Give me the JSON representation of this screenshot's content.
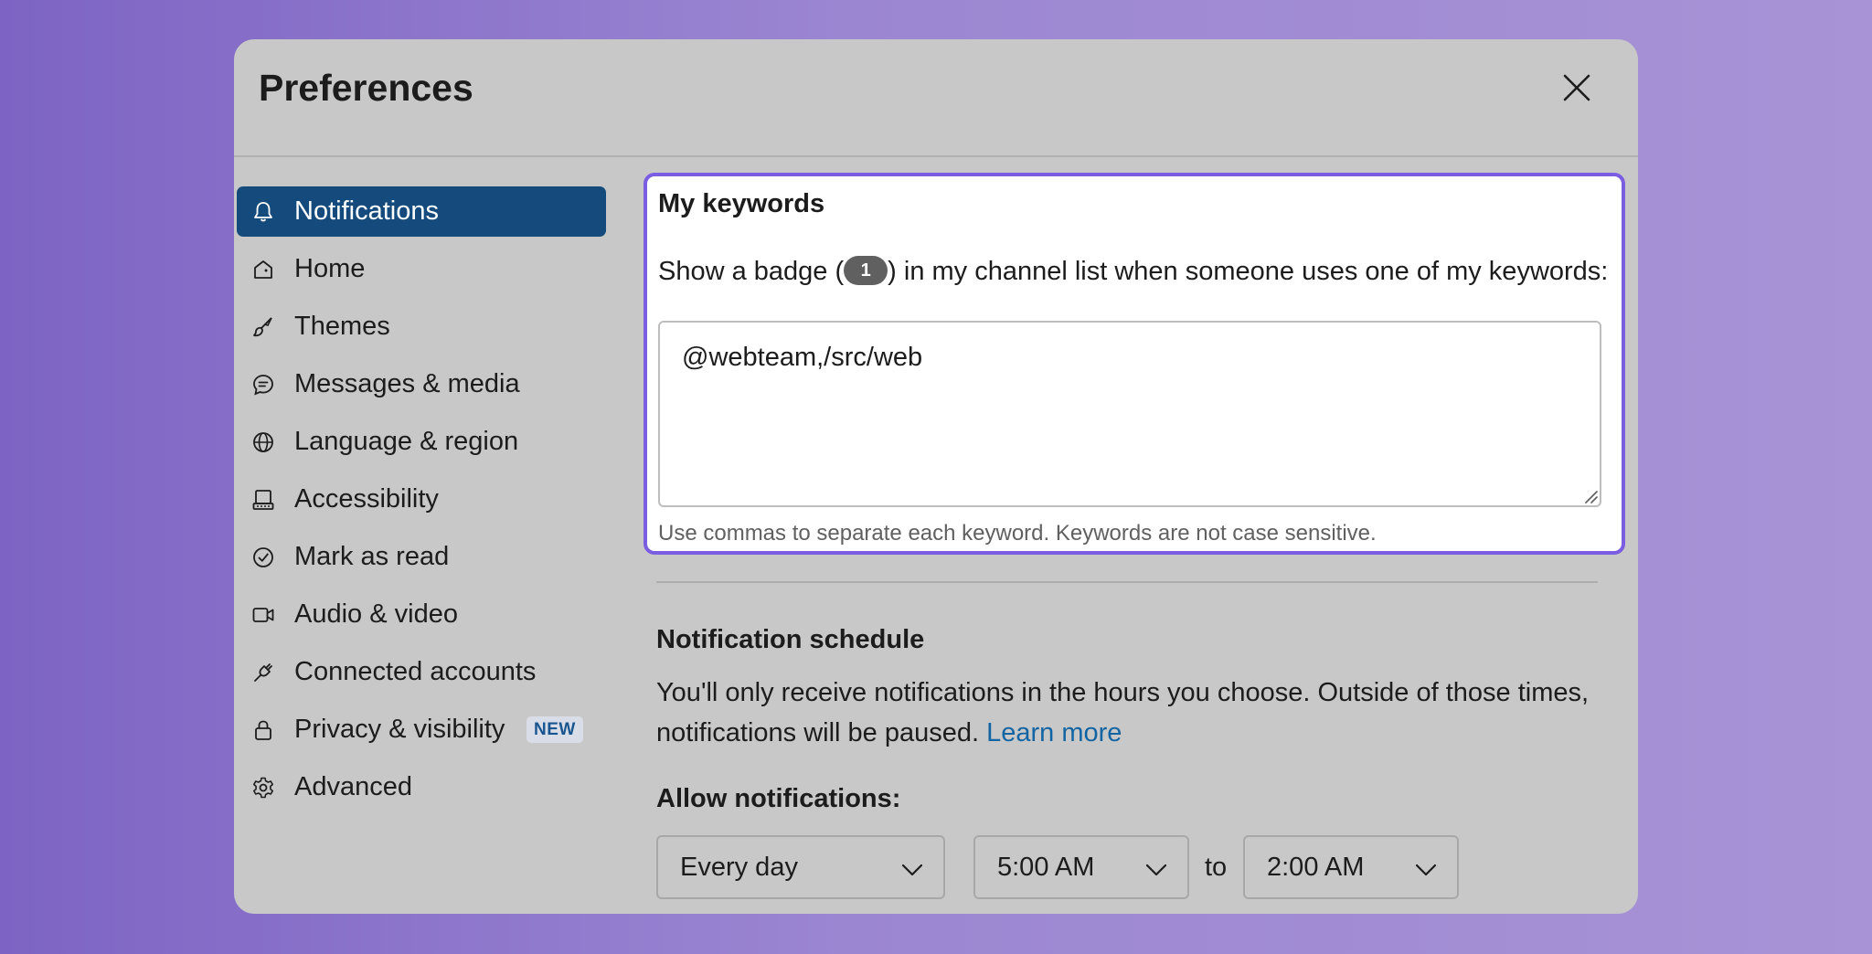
{
  "modal": {
    "title": "Preferences"
  },
  "sidebar": {
    "items": [
      {
        "label": "Notifications",
        "icon": "bell-icon",
        "active": true
      },
      {
        "label": "Home",
        "icon": "home-icon"
      },
      {
        "label": "Themes",
        "icon": "brush-icon"
      },
      {
        "label": "Messages & media",
        "icon": "message-icon"
      },
      {
        "label": "Language & region",
        "icon": "globe-icon"
      },
      {
        "label": "Accessibility",
        "icon": "keyboard-icon"
      },
      {
        "label": "Mark as read",
        "icon": "check-circle-icon"
      },
      {
        "label": "Audio & video",
        "icon": "video-icon"
      },
      {
        "label": "Connected accounts",
        "icon": "plug-icon"
      },
      {
        "label": "Privacy & visibility",
        "icon": "lock-icon",
        "badge": "NEW"
      },
      {
        "label": "Advanced",
        "icon": "gear-icon"
      }
    ]
  },
  "keywords": {
    "title": "My keywords",
    "desc_before": "Show a badge (",
    "badge": "1",
    "desc_after": ") in my channel list when someone uses one of my keywords:",
    "value": "@webteam,/src/web",
    "hint": "Use commas to separate each keyword. Keywords are not case sensitive."
  },
  "schedule": {
    "title": "Notification schedule",
    "desc": "You'll only receive notifications in the hours you choose. Outside of those times, notifications will be paused. ",
    "learn_more": "Learn more",
    "allow_title": "Allow notifications:",
    "days": "Every day",
    "start": "5:00 AM",
    "to": "to",
    "end": "2:00 AM"
  },
  "colors": {
    "accent": "#7a5de0",
    "active_nav": "#154b7c",
    "link": "#1264a3"
  }
}
